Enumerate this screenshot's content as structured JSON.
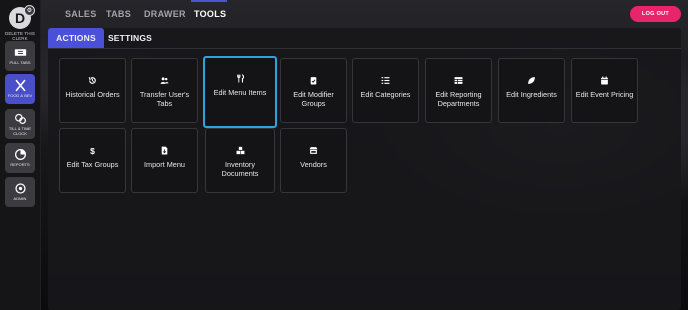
{
  "sidebar": {
    "avatar_letter": "D",
    "avatar_badge": "⚙",
    "clerk_label": "DELETE THIS CLERK",
    "items": [
      {
        "label": "PULL TABS",
        "icon": "ticket-icon",
        "active": false
      },
      {
        "label": "FOOD & BEV",
        "icon": "fork-knife-icon",
        "active": true
      },
      {
        "label": "TILL & TIME CLOCK",
        "icon": "coins-icon",
        "active": false
      },
      {
        "label": "REPORTS",
        "icon": "pie-chart-icon",
        "active": false
      },
      {
        "label": "ADMIN",
        "icon": "settings-icon",
        "active": false
      }
    ]
  },
  "top_tabs": [
    {
      "label": "SALES"
    },
    {
      "label": "TABS"
    },
    {
      "label": "DRAWER"
    },
    {
      "label": "TOOLS",
      "active": true
    }
  ],
  "logout_label": "LOG OUT",
  "sub_tabs": [
    {
      "label": "ACTIONS",
      "active": true
    },
    {
      "label": "SETTINGS"
    }
  ],
  "tiles": [
    {
      "label": "Historical Orders",
      "icon": "history-icon"
    },
    {
      "label": "Transfer User's Tabs",
      "icon": "users-icon"
    },
    {
      "label": "Edit Menu Items",
      "icon": "utensils-icon",
      "selected": true
    },
    {
      "label": "Edit Modifier Groups",
      "icon": "clipboard-check-icon"
    },
    {
      "label": "Edit Categories",
      "icon": "list-icon"
    },
    {
      "label": "Edit Reporting Departments",
      "icon": "table-icon"
    },
    {
      "label": "Edit Ingredients",
      "icon": "leaf-icon"
    },
    {
      "label": "Edit Event Pricing",
      "icon": "calendar-icon"
    },
    {
      "label": "Edit Tax Groups",
      "icon": "dollar-icon"
    },
    {
      "label": "Import Menu",
      "icon": "file-import-icon"
    },
    {
      "label": "Inventory Documents",
      "icon": "boxes-icon"
    },
    {
      "label": "Vendors",
      "icon": "store-icon"
    }
  ],
  "colors": {
    "accent": "#4a51d8",
    "logout": "#e8246b",
    "selected_border": "#2aa4e0"
  }
}
